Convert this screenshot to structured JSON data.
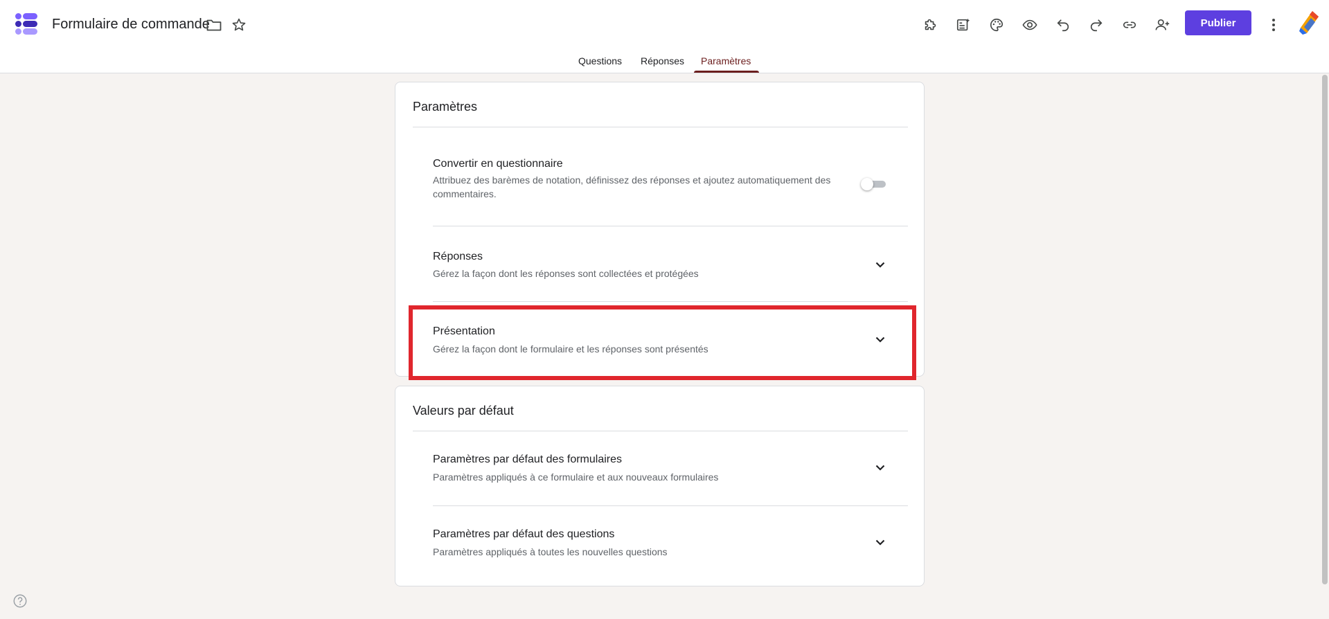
{
  "app": {
    "document_title": "Formulaire de commande",
    "brand_color": "#5d3fe0",
    "icons": [
      "forms-logo",
      "folder-icon",
      "star-icon"
    ]
  },
  "toolbar": {
    "icons": [
      "addon-puzzle-icon",
      "ai-assist-icon",
      "palette-icon",
      "preview-eye-icon",
      "undo-icon",
      "redo-icon",
      "link-icon",
      "add-collaborator-icon",
      "more-vert-icon",
      "account-icon"
    ],
    "publish_label": "Publier"
  },
  "tabs": {
    "items": [
      {
        "label": "Questions"
      },
      {
        "label": "Réponses"
      },
      {
        "label": "Paramètres"
      }
    ],
    "active": "Paramètres",
    "active_color": "#6b1d1d"
  },
  "settings_card": {
    "title": "Paramètres",
    "rows": [
      {
        "title": "Convertir en questionnaire",
        "description": "Attribuez des barèmes de notation, définissez des réponses et ajoutez automatiquement des commentaires.",
        "control": "toggle",
        "enabled": false
      },
      {
        "title": "Réponses",
        "description": "Gérez la façon dont les réponses sont collectées et protégées",
        "control": "chevron-down-icon"
      },
      {
        "title": "Présentation",
        "description": "Gérez la façon dont le formulaire et les réponses sont présentés",
        "control": "chevron-down-icon",
        "highlighted": true
      }
    ]
  },
  "defaults_card": {
    "title": "Valeurs par défaut",
    "rows": [
      {
        "title": "Paramètres par défaut des formulaires",
        "description": "Paramètres appliqués à ce formulaire et aux nouveaux formulaires",
        "control": "chevron-down-icon"
      },
      {
        "title": "Paramètres par défaut des questions",
        "description": "Paramètres appliqués à toutes les nouvelles questions",
        "control": "chevron-down-icon"
      }
    ]
  },
  "highlight_color": "#e0262d",
  "footer": {
    "help_icon": "help-circle-icon"
  }
}
